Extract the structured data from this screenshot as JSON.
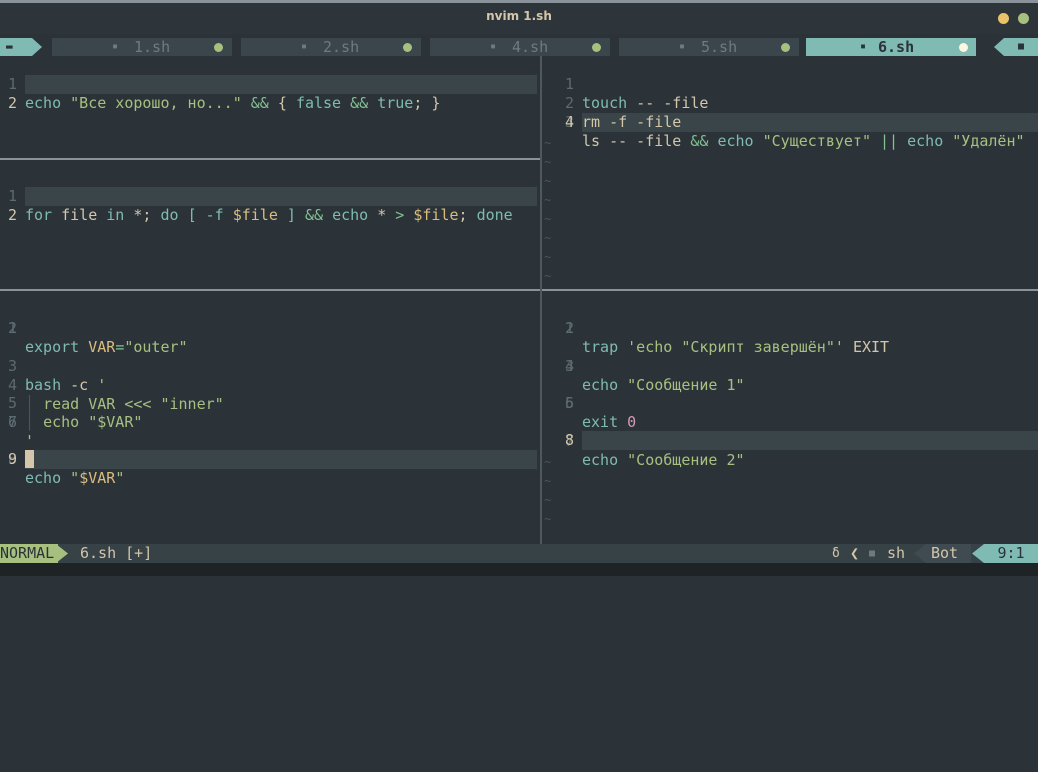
{
  "window": {
    "title": "nvim 1.sh"
  },
  "tabs": [
    {
      "label": "1.sh",
      "active": false
    },
    {
      "label": "2.sh",
      "active": false
    },
    {
      "label": "4.sh",
      "active": false
    },
    {
      "label": "5.sh",
      "active": false
    },
    {
      "label": "6.sh",
      "active": true
    }
  ],
  "panes": {
    "top_left": {
      "lines": [
        "echo \"Все хорошо, но...\" && { false && true; }",
        ""
      ]
    },
    "middle_left": {
      "lines": [
        "for file in *; do [ -f $file ] && echo * > $file; done",
        ""
      ]
    },
    "bottom_left": {
      "lines": [
        "export VAR=\"outer\"",
        "",
        "bash -c '",
        "  read VAR <<< \"inner\"",
        "  echo \"$VAR\"",
        "'",
        "",
        "echo \"$VAR\"",
        ""
      ]
    },
    "top_right": {
      "lines": [
        "touch -- -file",
        "rm -f -file",
        "ls -- -file && echo \"Существует\" || echo \"Удалён\"",
        ""
      ]
    },
    "bottom_right": {
      "lines": [
        "trap 'echo \"Скрипт завершён\"' EXIT",
        "",
        "echo \"Сообщение 1\"",
        "",
        "exit 0",
        "",
        "echo \"Сообщение 2\"",
        ""
      ]
    }
  },
  "numbers": [
    "1",
    "2",
    "3",
    "4",
    "5",
    "6",
    "7",
    "8",
    "9"
  ],
  "statusline": {
    "mode": "NORMAL",
    "filename": "6.sh [+]",
    "filetype": "sh",
    "position_label": "Bot",
    "cursor_pos": "9:1",
    "branch_symbol": "δ"
  },
  "colors": {
    "background": "#2b3339",
    "accent_blue": "#7fbbb3",
    "accent_green": "#a7c080",
    "keyword": "#7fbbb3",
    "string": "#a7c080",
    "variable": "#dbbc7f",
    "number": "#d699b6"
  },
  "icons": {
    "buffer": "folder-icon",
    "terminal": "terminal-icon",
    "modified": "dot-icon",
    "tilde": "~"
  }
}
